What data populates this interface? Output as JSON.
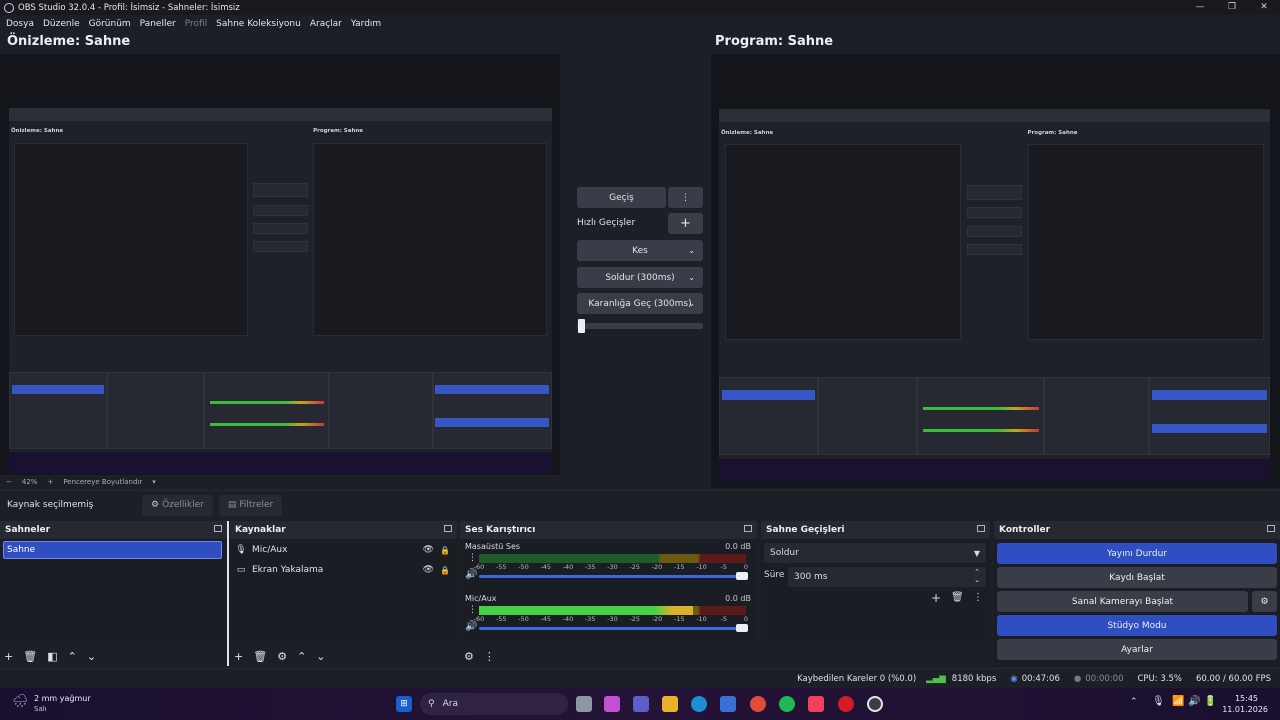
{
  "window": {
    "title": "OBS Studio 32.0.4 - Profil: İsimsiz - Sahneler: İsimsiz"
  },
  "menu": [
    "Dosya",
    "Düzenle",
    "Görünüm",
    "Paneller",
    "Profil",
    "Sahne Koleksiyonu",
    "Araçlar",
    "Yardım"
  ],
  "preview": {
    "title": "Önizleme: Sahne",
    "zoom_minus": "−",
    "zoom": "42%",
    "zoom_plus": "+",
    "resize_label": "Pencereye Boyutlandır",
    "resize_chevron": "▾"
  },
  "program": {
    "title": "Program: Sahne"
  },
  "transitions_panel": {
    "transition_button": "Geçiş",
    "quick_label": "Hızlı Geçişler",
    "quick_items": [
      "Kes",
      "Soldur (300ms)",
      "Karanlığa Geç (300ms)"
    ]
  },
  "source_bar": {
    "status": "Kaynak seçilmemiş",
    "properties": "Özellikler",
    "filters": "Filtreler"
  },
  "scenes": {
    "title": "Sahneler",
    "items": [
      "Sahne"
    ]
  },
  "sources": {
    "title": "Kaynaklar",
    "items": [
      {
        "name": "Mic/Aux",
        "icon": "microphone-icon"
      },
      {
        "name": "Ekran Yakalama",
        "icon": "monitor-icon"
      }
    ]
  },
  "mixer": {
    "title": "Ses Karıştırıcı",
    "scale": [
      "-60",
      "-55",
      "-50",
      "-45",
      "-40",
      "-35",
      "-30",
      "-25",
      "-20",
      "-15",
      "-10",
      "-5",
      "0"
    ],
    "channels": [
      {
        "name": "Masaüstü Ses",
        "db": "0.0 dB",
        "level": 0.0
      },
      {
        "name": "Mic/Aux",
        "db": "0.0 dB",
        "level": 0.8
      }
    ]
  },
  "scene_transitions": {
    "title": "Sahne Geçişleri",
    "selected": "Soldur",
    "duration_label": "Süre",
    "duration_value": "300 ms"
  },
  "controls": {
    "title": "Kontroller",
    "buttons": [
      "Yayını Durdur",
      "Kaydı Başlat",
      "Sanal Kamerayı Başlat",
      "Stüdyo Modu",
      "Ayarlar"
    ]
  },
  "status": {
    "dropped": "Kaybedilen Kareler 0 (%0.0)",
    "bitrate": "8180 kbps",
    "stream_time": "00:47:06",
    "rec_time": "00:00:00",
    "cpu": "CPU: 3.5%",
    "fps": "60.00 / 60.00 FPS"
  },
  "taskbar": {
    "weather_temp": "2 mm yağmur",
    "weather_day": "Salı",
    "search": "Ara",
    "time": "15:45",
    "date": "11.01.2026"
  },
  "colors": {
    "accent": "#2e4ec1",
    "background": "#1d1f26",
    "panel": "#262931"
  }
}
